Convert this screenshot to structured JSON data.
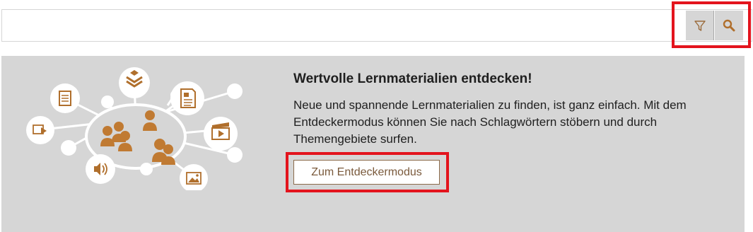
{
  "search": {
    "value": "",
    "placeholder": "",
    "filter_icon": "filter-icon",
    "search_icon": "search-icon"
  },
  "discover": {
    "title": "Wertvolle Lernmaterialien entdecken!",
    "text": "Neue und spannende Lernmaterialien zu finden, ist ganz einfach. Mit dem Entdeckermodus können Sie nach Schlagwörtern stöbern und durch Themengebiete surfen.",
    "button_label": "Zum Entdeckermodus",
    "illustration": "network-of-people-and-media-icons"
  },
  "colors": {
    "accent": "#c07a32",
    "panel_bg": "#d6d6d6",
    "highlight": "#e3141d",
    "button_text": "#7a5a3c"
  }
}
